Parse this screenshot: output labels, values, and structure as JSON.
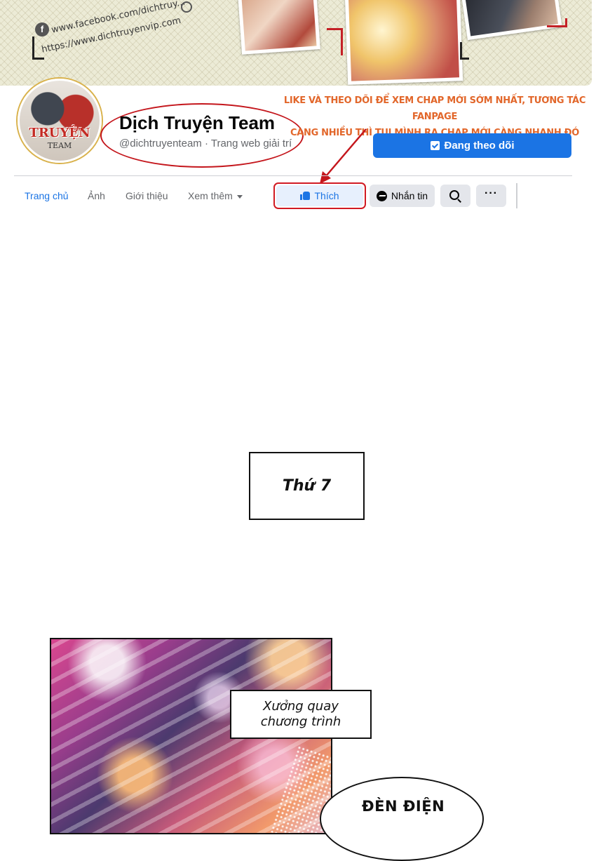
{
  "banner": {
    "facebook_url": "www.facebook.com/dichtruy...",
    "website_url": "https://www.dichtruyenvip.com"
  },
  "profile": {
    "avatar_text": "TRUYỆN",
    "avatar_subtext": "TEAM",
    "page_name": "Dịch Truyện Team",
    "handle": "@dichtruyenteam · Trang web giải trí",
    "follow_button": "Đang theo dõi"
  },
  "promo": {
    "line1": "LIKE  VÀ THEO DÕI ĐỂ XEM CHAP MỚI SỚM NHẤT, TƯƠNG TÁC FANPAGE",
    "line2": "CÀNG NHIỀU THÌ TỤI MÌNH RA CHAP MỚI CÀNG NHANH ĐÓ NHA!"
  },
  "nav": {
    "home": "Trang chủ",
    "photos": "Ảnh",
    "about": "Giới thiệu",
    "more": "Xem thêm",
    "like": "Thích",
    "message": "Nhắn tin",
    "more_dots": "···"
  },
  "comic": {
    "caption_day": "Thứ 7",
    "caption_studio_1": "Xưởng quay",
    "caption_studio_2": "chương trình",
    "bubble": "ĐÈN ĐIỆN"
  },
  "colors": {
    "accent_blue": "#1b74e4",
    "highlight_red": "#c4161c",
    "promo_orange": "#e2672b"
  }
}
